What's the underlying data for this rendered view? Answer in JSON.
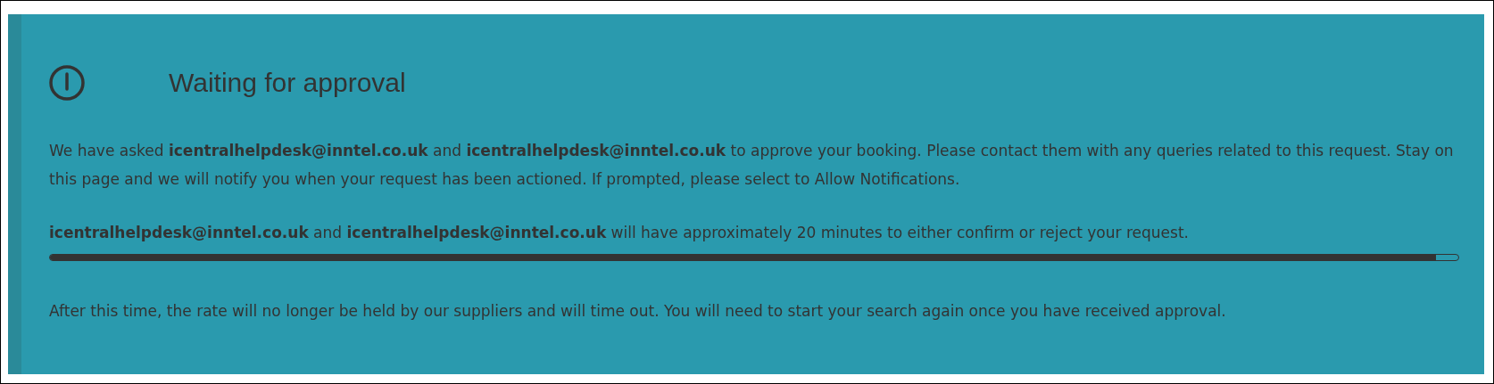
{
  "panel": {
    "title": "Waiting for approval",
    "message": "We have asked **icentralhelpdesk@inntel.co.uk** and **icentralhelpdesk@inntel.co.uk** to approve your booking. Please contact them with any queries related to this request. Stay on this page and we will notify you when your request has been actioned. If prompted, please select to Allow Notifications.",
    "deadline": "**icentralhelpdesk@inntel.co.uk** and **icentralhelpdesk@inntel.co.uk** will have approximately 20 minutes to either confirm or reject your request.",
    "progress": {
      "level": 0.984
    },
    "footnote": "After this time, the rate will no longer be held by our suppliers and will time out. You will need to start your search again once you have received approval."
  }
}
